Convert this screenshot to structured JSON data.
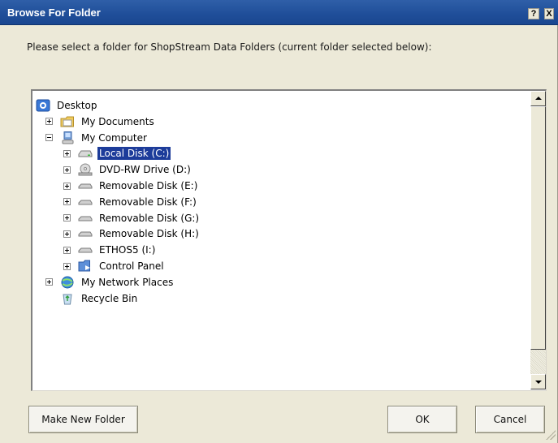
{
  "window": {
    "title": "Browse For Folder",
    "help_label": "?",
    "close_label": "X"
  },
  "instruction": "Please select a folder for ShopStream Data Folders (current folder selected below):",
  "tree": {
    "items": [
      {
        "label": "Desktop",
        "icon": "desktop-icon",
        "level": 0,
        "expander": "none",
        "selected": false
      },
      {
        "label": "My Documents",
        "icon": "folder-documents-icon",
        "level": 1,
        "expander": "plus",
        "selected": false
      },
      {
        "label": "My Computer",
        "icon": "computer-icon",
        "level": 1,
        "expander": "minus",
        "selected": false
      },
      {
        "label": "Local Disk (C:)",
        "icon": "disk-drive-icon",
        "level": 2,
        "expander": "plus",
        "selected": true
      },
      {
        "label": "DVD-RW Drive (D:)",
        "icon": "dvd-drive-icon",
        "level": 2,
        "expander": "plus",
        "selected": false
      },
      {
        "label": "Removable Disk (E:)",
        "icon": "removable-disk-icon",
        "level": 2,
        "expander": "plus",
        "selected": false
      },
      {
        "label": "Removable Disk (F:)",
        "icon": "removable-disk-icon",
        "level": 2,
        "expander": "plus",
        "selected": false
      },
      {
        "label": "Removable Disk (G:)",
        "icon": "removable-disk-icon",
        "level": 2,
        "expander": "plus",
        "selected": false
      },
      {
        "label": "Removable Disk (H:)",
        "icon": "removable-disk-icon",
        "level": 2,
        "expander": "plus",
        "selected": false
      },
      {
        "label": "ETHOS5 (I:)",
        "icon": "removable-disk-icon",
        "level": 2,
        "expander": "plus",
        "selected": false
      },
      {
        "label": "Control Panel",
        "icon": "control-panel-icon",
        "level": 2,
        "expander": "plus",
        "selected": false
      },
      {
        "label": "My Network Places",
        "icon": "network-places-icon",
        "level": 1,
        "expander": "plus",
        "selected": false
      },
      {
        "label": "Recycle Bin",
        "icon": "recycle-bin-icon",
        "level": 1,
        "expander": "none",
        "selected": false
      }
    ]
  },
  "buttons": {
    "make_new_folder": "Make New Folder",
    "ok": "OK",
    "cancel": "Cancel"
  },
  "colors": {
    "title_bar": "#1f4e99",
    "selection": "#1d3c9a",
    "dialog_background": "#ece9d8"
  }
}
